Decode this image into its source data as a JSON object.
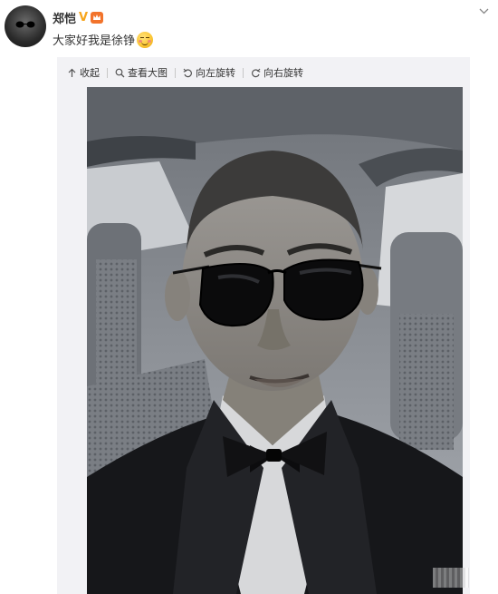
{
  "post": {
    "author": "郑恺",
    "verified_badge": "V",
    "text": "大家好我是徐铮"
  },
  "icons": {
    "avatar": "avatar",
    "emoji": "smile-emoji-icon",
    "menu": "chevron-down-icon"
  },
  "toolbar": {
    "collapse": "收起",
    "view_large": "查看大图",
    "rotate_left": "向左旋转",
    "rotate_right": "向右旋转"
  },
  "colors": {
    "badge": "#f7a51c",
    "media_bg": "#f2f2f5"
  }
}
